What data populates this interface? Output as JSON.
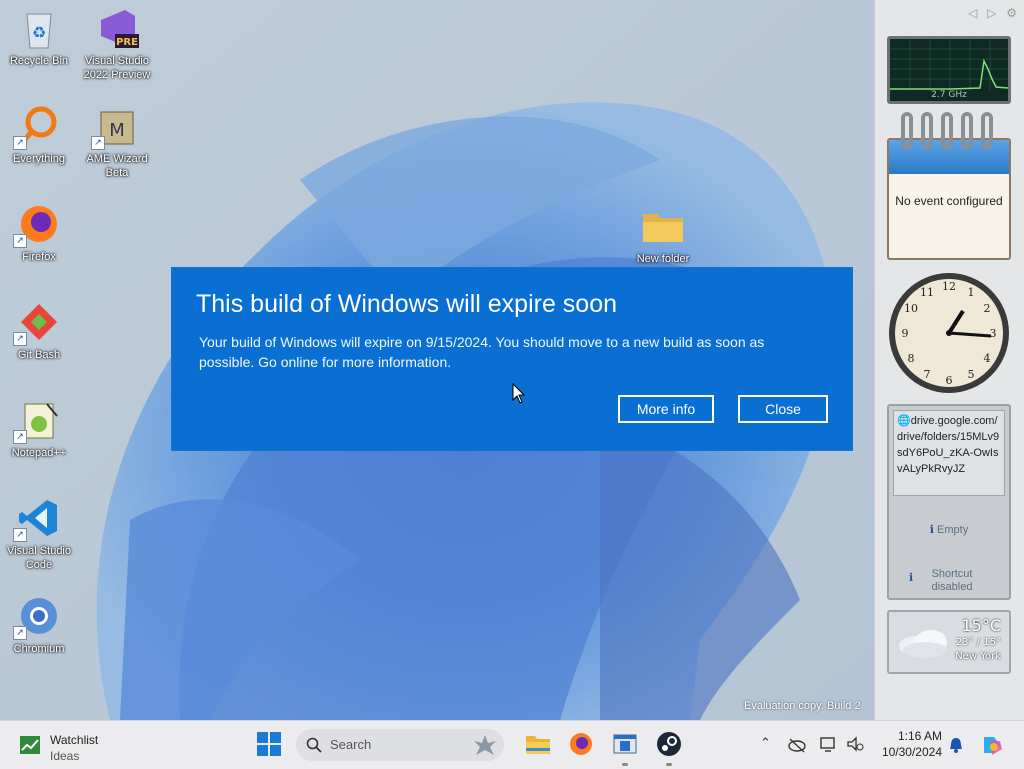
{
  "desktop": {
    "icons": [
      {
        "label": "Recycle Bin"
      },
      {
        "label": "Visual Studio 2022 Preview",
        "badge": "PRE"
      },
      {
        "label": "Everything"
      },
      {
        "label": "AME Wizard Beta"
      },
      {
        "label": "Firefox"
      },
      {
        "label": "Git Bash"
      },
      {
        "label": "Notepad++"
      },
      {
        "label": "Visual Studio Code"
      },
      {
        "label": "Chromium"
      },
      {
        "label": "New folder"
      }
    ],
    "watermark": "Evaluation copy. Build 2"
  },
  "dialog": {
    "title": "This build of Windows will expire soon",
    "body": "Your build of Windows will expire on 9/15/2024. You should move to a new build as soon as possible. Go online for more information.",
    "more_info": "More info",
    "close": "Close",
    "background": "#0a6fd3"
  },
  "sidebar": {
    "cpu_label": "2.7 GHz",
    "calendar_text": "No event configured",
    "slideshow_url": "drive.google.com/drive/folders/15MLv9sdY6PoU_zKA-OwIsvALyPkRvyJZ",
    "status_empty": "Empty",
    "status_shortcut": "Shortcut disabled",
    "weather_temp": "15°C",
    "weather_range": "23° / 15°",
    "weather_city": "New York"
  },
  "taskbar": {
    "widget_title": "Watchlist",
    "widget_sub": "Ideas",
    "search_placeholder": "Search",
    "time": "1:16 AM",
    "date": "10/30/2024"
  }
}
